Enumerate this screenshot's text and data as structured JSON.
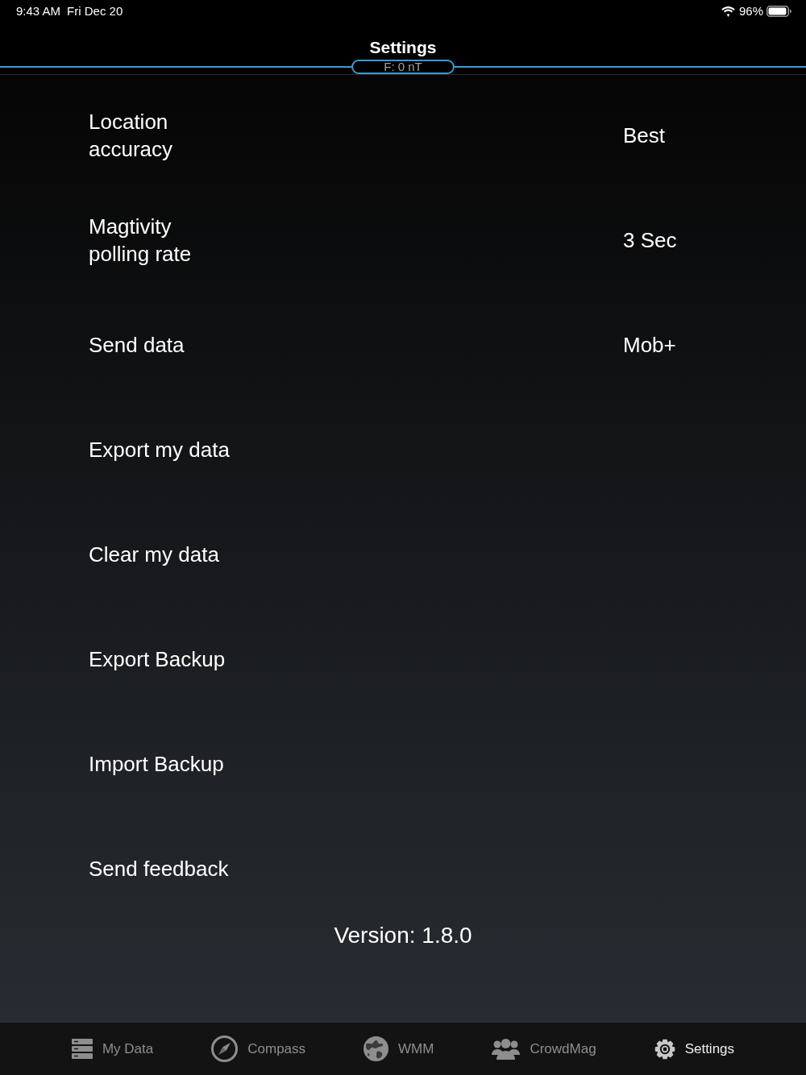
{
  "status_bar": {
    "time": "9:43 AM",
    "date": "Fri Dec 20",
    "battery": "96%"
  },
  "nav": {
    "title": "Settings",
    "field_reading": "F: 0 nT"
  },
  "settings": [
    {
      "label": "Location accuracy",
      "value": "Best"
    },
    {
      "label": "Magtivity polling rate",
      "value": "3 Sec"
    },
    {
      "label": "Send data",
      "value": "Mob+"
    },
    {
      "label": "Export my data"
    },
    {
      "label": "Clear my data"
    },
    {
      "label": "Export Backup"
    },
    {
      "label": "Import Backup"
    },
    {
      "label": "Send feedback"
    }
  ],
  "version": "Version: 1.8.0",
  "tab_bar": [
    {
      "kind": "list",
      "label": "My Data",
      "selected": false
    },
    {
      "kind": "compass",
      "label": "Compass",
      "selected": false
    },
    {
      "kind": "globe",
      "label": "WMM",
      "selected": false
    },
    {
      "kind": "people",
      "label": "CrowdMag",
      "selected": false
    },
    {
      "kind": "gear",
      "label": "Settings",
      "selected": true
    }
  ]
}
